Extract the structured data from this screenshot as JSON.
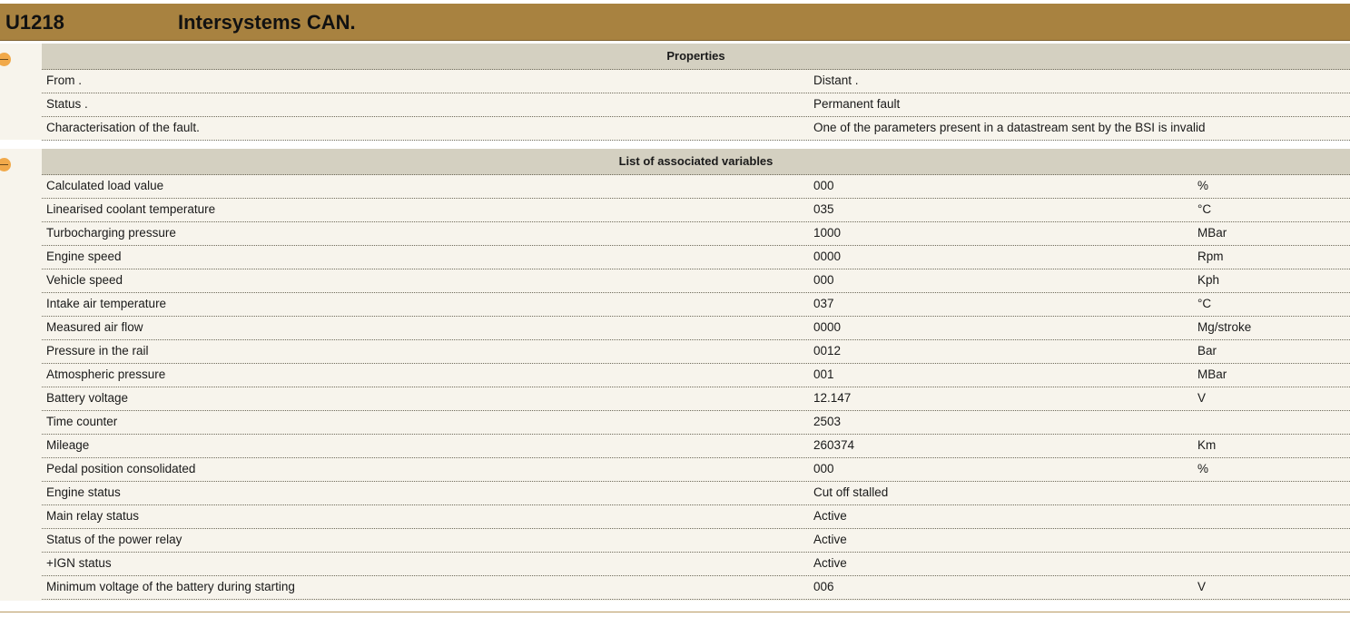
{
  "header": {
    "code": "U1218",
    "title": "Intersystems CAN."
  },
  "properties": {
    "heading": "Properties",
    "rows": [
      {
        "label": "From .",
        "value": "Distant ."
      },
      {
        "label": "Status .",
        "value": "Permanent fault"
      },
      {
        "label": "Characterisation of the fault.",
        "value": "One of the parameters present in a datastream sent by the BSI is invalid"
      }
    ]
  },
  "variables": {
    "heading": "List of associated variables",
    "rows": [
      {
        "name": "Calculated load value",
        "value": "000",
        "unit": "%"
      },
      {
        "name": "Linearised coolant temperature",
        "value": "035",
        "unit": "°C"
      },
      {
        "name": "Turbocharging pressure",
        "value": "1000",
        "unit": "MBar"
      },
      {
        "name": "Engine speed",
        "value": "0000",
        "unit": "Rpm"
      },
      {
        "name": "Vehicle speed",
        "value": "000",
        "unit": "Kph"
      },
      {
        "name": "Intake air temperature",
        "value": "037",
        "unit": "°C"
      },
      {
        "name": "Measured air flow",
        "value": "0000",
        "unit": "Mg/stroke"
      },
      {
        "name": "Pressure in the rail",
        "value": "0012",
        "unit": "Bar"
      },
      {
        "name": "Atmospheric pressure",
        "value": "001",
        "unit": "MBar"
      },
      {
        "name": "Battery voltage",
        "value": "12.147",
        "unit": "V"
      },
      {
        "name": "Time counter",
        "value": "2503",
        "unit": ""
      },
      {
        "name": "Mileage",
        "value": "260374",
        "unit": "Km"
      },
      {
        "name": "Pedal position consolidated",
        "value": "000",
        "unit": "%"
      },
      {
        "name": "Engine status",
        "value": "Cut off stalled",
        "unit": ""
      },
      {
        "name": "Main relay status",
        "value": "Active",
        "unit": ""
      },
      {
        "name": "Status of the power relay",
        "value": "Active",
        "unit": ""
      },
      {
        "name": "+IGN status",
        "value": "Active",
        "unit": ""
      },
      {
        "name": "Minimum voltage of the battery during starting",
        "value": "006",
        "unit": "V"
      }
    ]
  },
  "colors": {
    "header_bar": "#a88240",
    "section_header": "#d4d0c1",
    "row_background": "#f7f4ec",
    "collapse_toggle": "#f1a94a"
  },
  "icons": {
    "collapse": "collapse-minus-icon"
  }
}
